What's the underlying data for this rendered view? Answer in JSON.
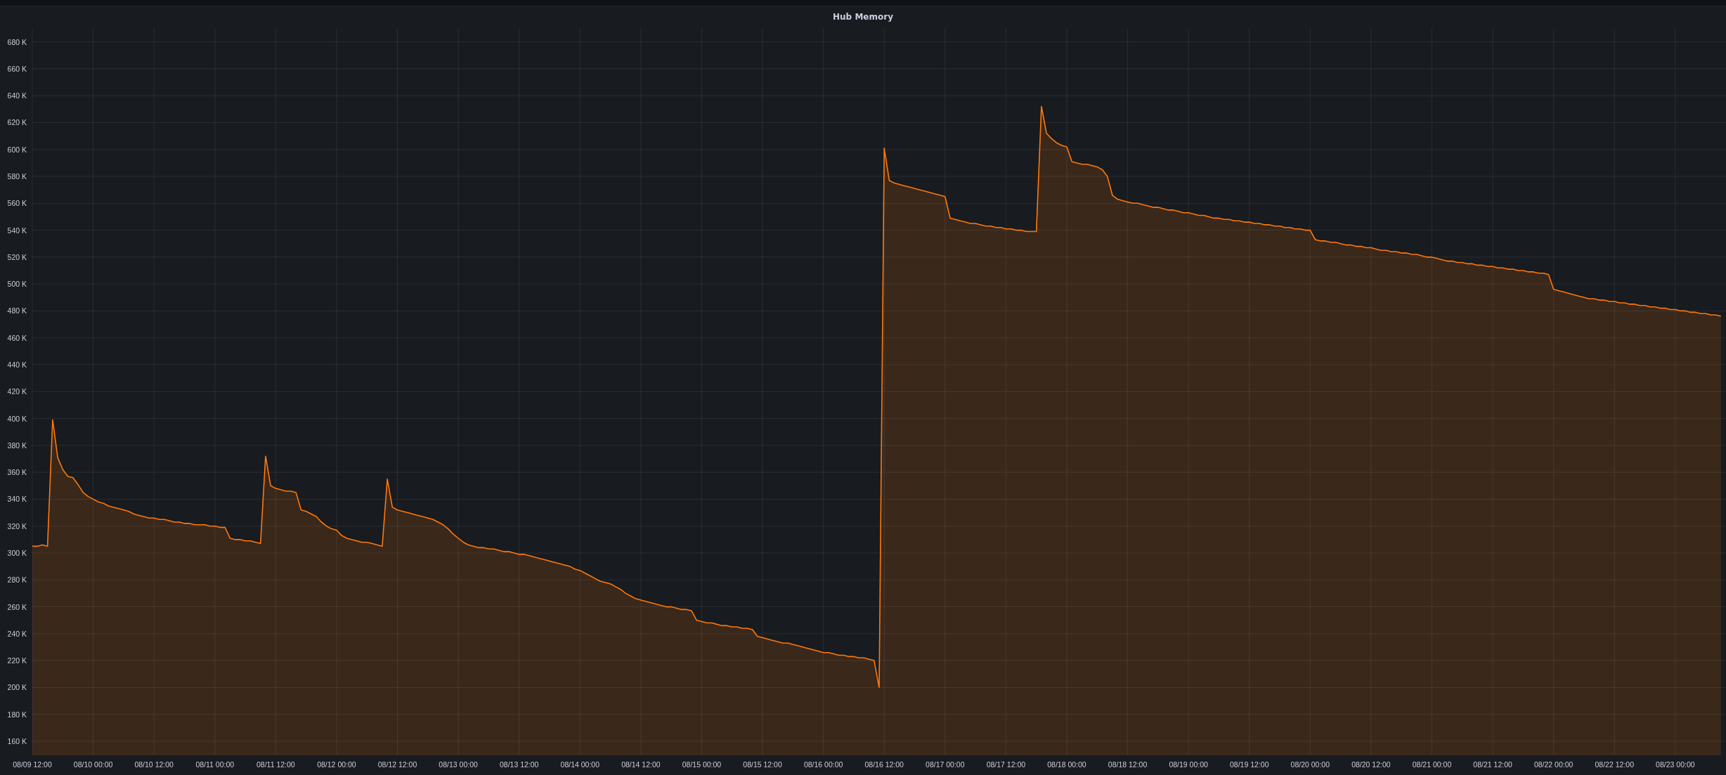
{
  "panel": {
    "chart_data": {
      "type": "area",
      "title": "Hub Memory",
      "grid": true,
      "categories": [
        "08/09 12:00",
        null,
        null,
        null,
        null,
        null,
        null,
        null,
        null,
        null,
        null,
        null,
        "08/10 00:00",
        null,
        null,
        null,
        null,
        null,
        null,
        null,
        null,
        null,
        null,
        null,
        "08/10 12:00",
        null,
        null,
        null,
        null,
        null,
        null,
        null,
        null,
        null,
        null,
        null,
        "08/11 00:00",
        null,
        null,
        null,
        null,
        null,
        null,
        null,
        null,
        null,
        null,
        null,
        "08/11 12:00",
        null,
        null,
        null,
        null,
        null,
        null,
        null,
        null,
        null,
        null,
        null,
        "08/12 00:00",
        null,
        null,
        null,
        null,
        null,
        null,
        null,
        null,
        null,
        null,
        null,
        "08/12 12:00",
        null,
        null,
        null,
        null,
        null,
        null,
        null,
        null,
        null,
        null,
        null,
        "08/13 00:00",
        null,
        null,
        null,
        null,
        null,
        null,
        null,
        null,
        null,
        null,
        null,
        "08/13 12:00",
        null,
        null,
        null,
        null,
        null,
        null,
        null,
        null,
        null,
        null,
        null,
        "08/14 00:00",
        null,
        null,
        null,
        null,
        null,
        null,
        null,
        null,
        null,
        null,
        null,
        "08/14 12:00",
        null,
        null,
        null,
        null,
        null,
        null,
        null,
        null,
        null,
        null,
        null,
        "08/15 00:00",
        null,
        null,
        null,
        null,
        null,
        null,
        null,
        null,
        null,
        null,
        null,
        "08/15 12:00",
        null,
        null,
        null,
        null,
        null,
        null,
        null,
        null,
        null,
        null,
        null,
        "08/16 00:00",
        null,
        null,
        null,
        null,
        null,
        null,
        null,
        null,
        null,
        null,
        null,
        "08/16 12:00",
        null,
        null,
        null,
        null,
        null,
        null,
        null,
        null,
        null,
        null,
        null,
        "08/17 00:00",
        null,
        null,
        null,
        null,
        null,
        null,
        null,
        null,
        null,
        null,
        null,
        "08/17 12:00",
        null,
        null,
        null,
        null,
        null,
        null,
        null,
        null,
        null,
        null,
        null,
        "08/18 00:00",
        null,
        null,
        null,
        null,
        null,
        null,
        null,
        null,
        null,
        null,
        null,
        "08/18 12:00",
        null,
        null,
        null,
        null,
        null,
        null,
        null,
        null,
        null,
        null,
        null,
        "08/19 00:00",
        null,
        null,
        null,
        null,
        null,
        null,
        null,
        null,
        null,
        null,
        null,
        "08/19 12:00",
        null,
        null,
        null,
        null,
        null,
        null,
        null,
        null,
        null,
        null,
        null,
        "08/20 00:00",
        null,
        null,
        null,
        null,
        null,
        null,
        null,
        null,
        null,
        null,
        null,
        "08/20 12:00",
        null,
        null,
        null,
        null,
        null,
        null,
        null,
        null,
        null,
        null,
        null,
        "08/21 00:00",
        null,
        null,
        null,
        null,
        null,
        null,
        null,
        null,
        null,
        null,
        null,
        "08/21 12:00",
        null,
        null,
        null,
        null,
        null,
        null,
        null,
        null,
        null,
        null,
        null,
        "08/22 00:00",
        null,
        null,
        null,
        null,
        null,
        null,
        null,
        null,
        null,
        null,
        null,
        "08/22 12:00",
        null,
        null,
        null,
        null,
        null,
        null,
        null,
        null,
        null,
        null,
        null,
        "08/23 00:00",
        null,
        null,
        null,
        null,
        null,
        null,
        null,
        null,
        null
      ],
      "series": [
        {
          "color": "#ff780a",
          "values": [
            305,
            305,
            306,
            305,
            399,
            371,
            362,
            357,
            356,
            351,
            345,
            342,
            340,
            338,
            337,
            335,
            334,
            333,
            332,
            331,
            329,
            328,
            327,
            326,
            326,
            325,
            325,
            324,
            323,
            323,
            322,
            322,
            321,
            321,
            321,
            320,
            320,
            319,
            319,
            311,
            310,
            310,
            309,
            309,
            308,
            307,
            372,
            350,
            348,
            347,
            346,
            346,
            345,
            332,
            331,
            329,
            327,
            323,
            320,
            318,
            317,
            313,
            311,
            310,
            309,
            308,
            308,
            307,
            306,
            305,
            355,
            334,
            332,
            331,
            330,
            329,
            328,
            327,
            326,
            325,
            323,
            321,
            318,
            314,
            311,
            308,
            306,
            305,
            304,
            304,
            303,
            303,
            302,
            301,
            301,
            300,
            299,
            299,
            298,
            297,
            296,
            295,
            294,
            293,
            292,
            291,
            290,
            288,
            287,
            285,
            283,
            281,
            279,
            278,
            277,
            275,
            273,
            270,
            268,
            266,
            265,
            264,
            263,
            262,
            261,
            260,
            260,
            259,
            258,
            258,
            257,
            250,
            249,
            248,
            248,
            247,
            246,
            246,
            245,
            245,
            244,
            244,
            243,
            238,
            237,
            236,
            235,
            234,
            233,
            233,
            232,
            231,
            230,
            229,
            228,
            227,
            226,
            226,
            225,
            224,
            224,
            223,
            223,
            222,
            222,
            221,
            220,
            200,
            601,
            577,
            575,
            574,
            573,
            572,
            571,
            570,
            569,
            568,
            567,
            566,
            565,
            549,
            548,
            547,
            546,
            545,
            545,
            544,
            543,
            543,
            542,
            542,
            541,
            541,
            540,
            540,
            539,
            539,
            539,
            632,
            612,
            608,
            605,
            603,
            602,
            591,
            590,
            589,
            589,
            588,
            587,
            585,
            580,
            566,
            563,
            562,
            561,
            560,
            560,
            559,
            558,
            557,
            557,
            556,
            555,
            555,
            554,
            553,
            553,
            552,
            551,
            551,
            550,
            549,
            549,
            548,
            548,
            547,
            547,
            546,
            546,
            545,
            545,
            544,
            544,
            543,
            543,
            542,
            542,
            541,
            541,
            540,
            540,
            533,
            532,
            532,
            531,
            531,
            530,
            529,
            529,
            528,
            528,
            527,
            527,
            526,
            525,
            525,
            524,
            524,
            523,
            523,
            522,
            522,
            521,
            520,
            520,
            519,
            518,
            517,
            517,
            516,
            516,
            515,
            515,
            514,
            514,
            513,
            513,
            512,
            512,
            511,
            511,
            510,
            510,
            509,
            509,
            508,
            508,
            507,
            496,
            495,
            494,
            493,
            492,
            491,
            490,
            489,
            489,
            488,
            488,
            487,
            487,
            486,
            486,
            485,
            485,
            484,
            484,
            483,
            483,
            482,
            482,
            481,
            481,
            480,
            480,
            479,
            479,
            478,
            478,
            477,
            477,
            476
          ]
        }
      ],
      "ylim": [
        160,
        680
      ],
      "yticks": [
        {
          "value": 160,
          "label": "160 K"
        },
        {
          "value": 180,
          "label": "180 K"
        },
        {
          "value": 200,
          "label": "200 K"
        },
        {
          "value": 220,
          "label": "220 K"
        },
        {
          "value": 240,
          "label": "240 K"
        },
        {
          "value": 260,
          "label": "260 K"
        },
        {
          "value": 280,
          "label": "280 K"
        },
        {
          "value": 300,
          "label": "300 K"
        },
        {
          "value": 320,
          "label": "320 K"
        },
        {
          "value": 340,
          "label": "340 K"
        },
        {
          "value": 360,
          "label": "360 K"
        },
        {
          "value": 380,
          "label": "380 K"
        },
        {
          "value": 400,
          "label": "400 K"
        },
        {
          "value": 420,
          "label": "420 K"
        },
        {
          "value": 440,
          "label": "440 K"
        },
        {
          "value": 460,
          "label": "460 K"
        },
        {
          "value": 480,
          "label": "480 K"
        },
        {
          "value": 500,
          "label": "500 K"
        },
        {
          "value": 520,
          "label": "520 K"
        },
        {
          "value": 540,
          "label": "540 K"
        },
        {
          "value": 560,
          "label": "560 K"
        },
        {
          "value": 580,
          "label": "580 K"
        },
        {
          "value": 600,
          "label": "600 K"
        },
        {
          "value": 620,
          "label": "620 K"
        },
        {
          "value": 640,
          "label": "640 K"
        },
        {
          "value": 660,
          "label": "660 K"
        },
        {
          "value": 680,
          "label": "680 K"
        }
      ]
    }
  }
}
